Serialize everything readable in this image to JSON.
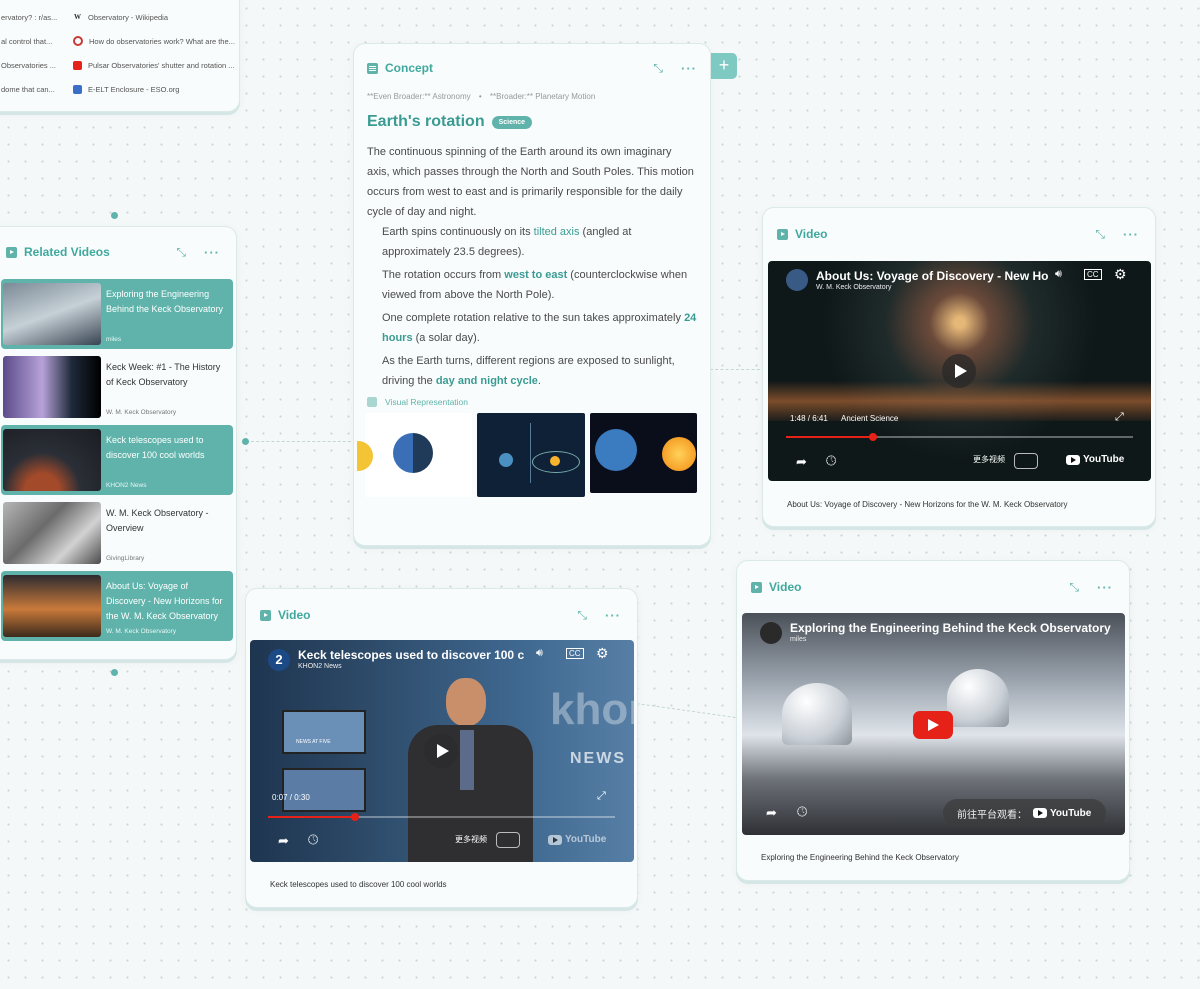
{
  "links_card": {
    "rows": [
      {
        "left": "ervatory? : r/as...",
        "icon": "wikipedia-icon",
        "right": "Observatory - Wikipedia"
      },
      {
        "left": "al control that...",
        "icon": "quora-icon",
        "right": "How do observatories work? What are the..."
      },
      {
        "left": "Observatories ...",
        "icon": "youtube-icon",
        "right": "Pulsar Observatories' shutter and rotation ..."
      },
      {
        "left": "dome that can...",
        "icon": "eso-icon",
        "right": "E-ELT Enclosure - ESO.org"
      }
    ]
  },
  "concept": {
    "header": "Concept",
    "breadcrumb_a": "**Even Broader:** Astronomy",
    "breadcrumb_b": "**Broader:** Planetary Motion",
    "title": "Earth's rotation",
    "tag": "Science",
    "intro": "The continuous spinning of the Earth around its own imaginary axis, which passes through the North and South Poles. This motion occurs from west to east and is primarily responsible for the daily cycle of day and night.",
    "b1_pre": "Earth spins continuously on its ",
    "b1_hl": "tilted axis",
    "b1_post": " (angled at approximately 23.5 degrees).",
    "b2_pre": "The rotation occurs from ",
    "b2_hl": "west to east",
    "b2_post": " (counterclockwise when viewed from above the North Pole).",
    "b3_pre": "One complete rotation relative to the sun takes approximately ",
    "b3_hl": "24 hours",
    "b3_post": " (a solar day).",
    "b4_pre": "As the Earth turns, different regions are exposed to sunlight, driving the ",
    "b4_hl": "day and night cycle",
    "b4_post": ".",
    "visual_label": "Visual Representation",
    "add_symbol": "+"
  },
  "related": {
    "header": "Related Videos",
    "items": [
      {
        "title": "Exploring the Engineering Behind the Keck Observatory",
        "channel": "miles"
      },
      {
        "title": "Keck Week: #1 - The History of Keck Observatory",
        "channel": "W. M. Keck Observatory"
      },
      {
        "title": "Keck telescopes used to discover 100 cool worlds",
        "channel": "KHON2 News"
      },
      {
        "title": "W. M. Keck Observatory - Overview",
        "channel": "GivingLibrary"
      },
      {
        "title": "About Us: Voyage of Discovery - New Horizons for the W. M. Keck Observatory",
        "channel": "W. M. Keck Observatory"
      }
    ]
  },
  "video1": {
    "header": "Video",
    "title": "About Us: Voyage of Discovery - New Ho",
    "channel": "W. M. Keck Observatory",
    "time": "1:48 / 6:41",
    "chapter": "Ancient Science",
    "more": "更多视频",
    "progress": 0.25,
    "caption": "About Us: Voyage of Discovery - New Horizons for the W. M. Keck Observatory",
    "yt": "YouTube"
  },
  "video2": {
    "header": "Video",
    "title": "Keck telescopes used to discover 100 c",
    "channel": "KHON2 News",
    "time": "0:07 / 0:30",
    "more": "更多视频",
    "progress": 0.25,
    "caption": "Keck telescopes used to discover 100 cool worlds",
    "bg_text": "khon",
    "bg_text2": "NEWS",
    "bg_text3": "NEWS AT FIVE",
    "yt": "YouTube"
  },
  "video3": {
    "header": "Video",
    "title": "Exploring the Engineering Behind the Keck Observatory",
    "channel": "miles",
    "watch_on": "前往平台观看：",
    "caption": "Exploring the Engineering Behind the Keck Observatory",
    "yt": "YouTube"
  }
}
